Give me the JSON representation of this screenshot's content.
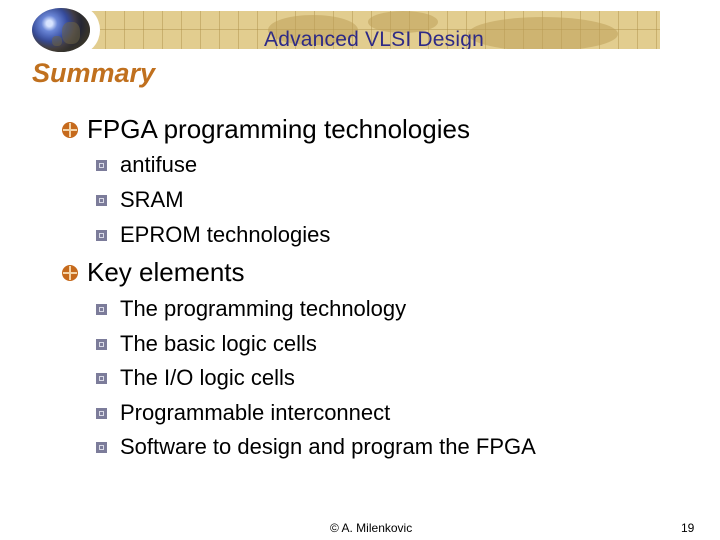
{
  "header": {
    "course_title": "Advanced VLSI Design",
    "logo": "globe-icon"
  },
  "slide": {
    "title": "Summary",
    "sections": [
      {
        "label": "FPGA programming technologies",
        "items": [
          "antifuse",
          "SRAM",
          "EPROM technologies"
        ]
      },
      {
        "label": "Key elements",
        "items": [
          "The programming technology",
          "The basic logic cells",
          "The I/O logic cells",
          "Programmable interconnect",
          "Software to design and program the FPGA"
        ]
      }
    ]
  },
  "footer": {
    "author": "© A. Milenkovic",
    "page_number": "19"
  },
  "colors": {
    "title": "#c0701e",
    "banner_text": "#2e2a86",
    "banner_bg": "#e2cd8f",
    "level1_bullet": "#c66a1c",
    "level2_bullet": "#7c7c9a"
  }
}
